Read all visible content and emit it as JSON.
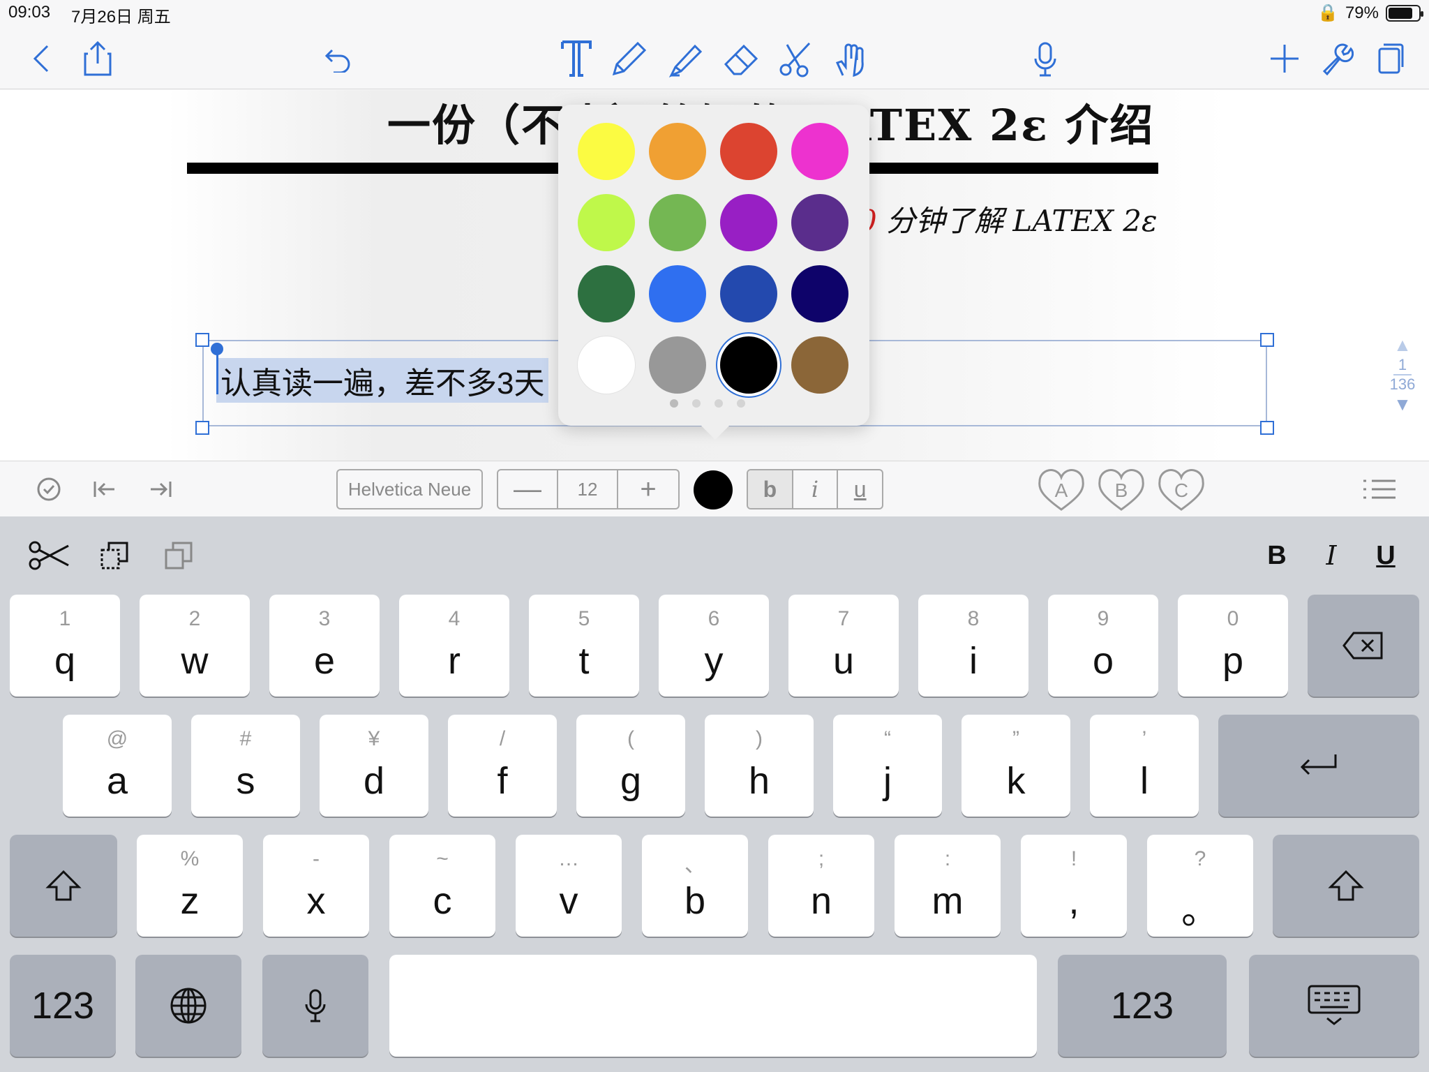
{
  "status_bar": {
    "time": "09:03",
    "date": "7月26日 周五",
    "battery": "79%"
  },
  "document": {
    "title": "一份（不太）简短的 LATEX 2ε 介绍",
    "subtitle_prefix": "0",
    "subtitle": " 分钟了解 LATEX 2ε",
    "selected_text": "认真读一遍，差不多3天",
    "page_indicator": {
      "current": "1",
      "total": "136"
    }
  },
  "format_bar": {
    "font_name": "Helvetica Neue",
    "font_size": "12",
    "minus": "—",
    "plus": "+",
    "bold": "b",
    "italic": "i",
    "underline": "u",
    "style_presets": [
      "A",
      "B",
      "C"
    ],
    "current_color": "#000000"
  },
  "color_palette": {
    "swatches": [
      "#fbfb42",
      "#f0a033",
      "#dc4430",
      "#ed32cf",
      "#bff84a",
      "#74b753",
      "#981fc4",
      "#5a2d8c",
      "#2d7040",
      "#2f6ff0",
      "#2349ae",
      "#0e036a",
      "#ffffff",
      "#989898",
      "#000000",
      "#8b6638"
    ],
    "selected_index": 14,
    "page_dots": 4
  },
  "keyboard": {
    "toolbar_right": {
      "bold": "B",
      "italic": "I",
      "underline": "U"
    },
    "row1": [
      {
        "sec": "1",
        "pri": "q"
      },
      {
        "sec": "2",
        "pri": "w"
      },
      {
        "sec": "3",
        "pri": "e"
      },
      {
        "sec": "4",
        "pri": "r"
      },
      {
        "sec": "5",
        "pri": "t"
      },
      {
        "sec": "6",
        "pri": "y"
      },
      {
        "sec": "7",
        "pri": "u"
      },
      {
        "sec": "8",
        "pri": "i"
      },
      {
        "sec": "9",
        "pri": "o"
      },
      {
        "sec": "0",
        "pri": "p"
      }
    ],
    "row2": [
      {
        "sec": "@",
        "pri": "a"
      },
      {
        "sec": "#",
        "pri": "s"
      },
      {
        "sec": "¥",
        "pri": "d"
      },
      {
        "sec": "/",
        "pri": "f"
      },
      {
        "sec": "(",
        "pri": "g"
      },
      {
        "sec": ")",
        "pri": "h"
      },
      {
        "sec": "“",
        "pri": "j"
      },
      {
        "sec": "”",
        "pri": "k"
      },
      {
        "sec": "’",
        "pri": "l"
      }
    ],
    "row3": [
      {
        "sec": "%",
        "pri": "z"
      },
      {
        "sec": "-",
        "pri": "x"
      },
      {
        "sec": "~",
        "pri": "c"
      },
      {
        "sec": "…",
        "pri": "v"
      },
      {
        "sec": "、",
        "pri": "b"
      },
      {
        "sec": ";",
        "pri": "n"
      },
      {
        "sec": ":",
        "pri": "m"
      },
      {
        "sec": "!",
        "pri": ","
      },
      {
        "sec": "?",
        "pri": "。"
      }
    ],
    "numbers_key": "123"
  }
}
